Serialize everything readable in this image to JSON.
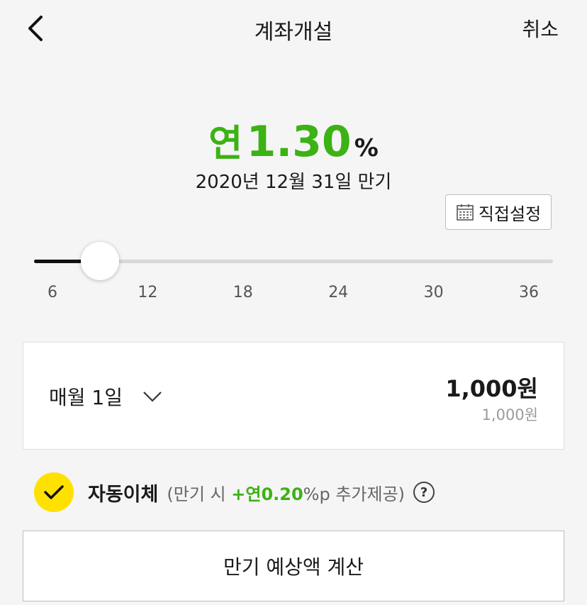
{
  "header": {
    "title": "계좌개설",
    "cancel_label": "취소",
    "back_icon": "chevron-left-icon"
  },
  "rate": {
    "prefix": "연",
    "value": "1.30",
    "unit": "%",
    "maturity_text": "2020년 12월 31일 만기"
  },
  "direct_setting": {
    "label": "직접설정",
    "icon": "calendar-icon"
  },
  "slider": {
    "ticks": [
      "6",
      "12",
      "18",
      "24",
      "30",
      "36"
    ],
    "min": 6,
    "max": 36,
    "value": 9
  },
  "deposit": {
    "day_label": "매월 1일",
    "amount": "1,000원",
    "amount_sub": "1,000원"
  },
  "auto_transfer": {
    "label": "자동이체",
    "desc_prefix": "(만기 시 ",
    "desc_bonus": "+연0.20",
    "desc_suffix": "%p 추가제공)",
    "help_icon": "?",
    "checked": true
  },
  "calc_button": {
    "label": "만기 예상액 계산"
  },
  "colors": {
    "accent_green": "#3cb214",
    "check_yellow": "#ffe100",
    "background": "#f5f5f5"
  }
}
